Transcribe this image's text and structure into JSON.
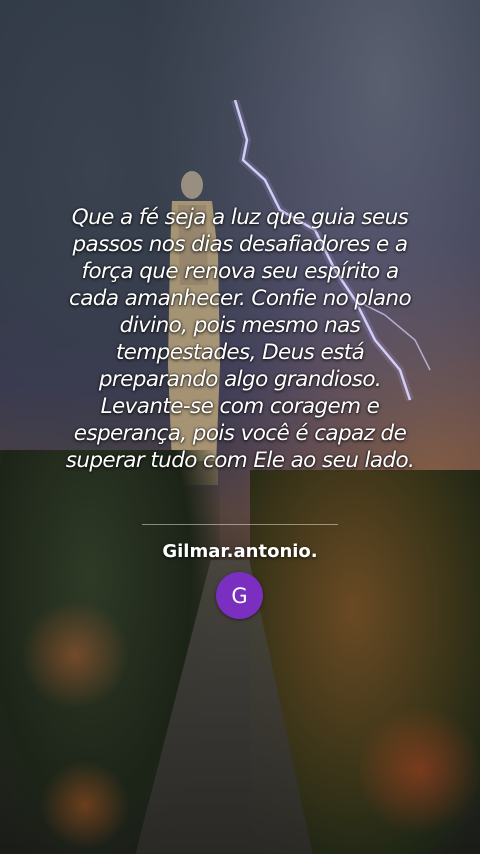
{
  "post": {
    "quote_lines": [
      "Que a fé seja a luz que guia seus",
      "passos nos dias desafiadores e a",
      "força que renova seu espírito a",
      "cada amanhecer. Confie no plano",
      "divino, pois mesmo nas",
      "tempestades, Deus está",
      "preparando algo grandioso.",
      "Levante-se com coragem e",
      "esperança, pois você é capaz de",
      "superar tudo com Ele ao seu lado."
    ],
    "author": "Gilmar.antonio.",
    "avatar_initial": "G",
    "avatar_color": "#7b2fc0"
  }
}
